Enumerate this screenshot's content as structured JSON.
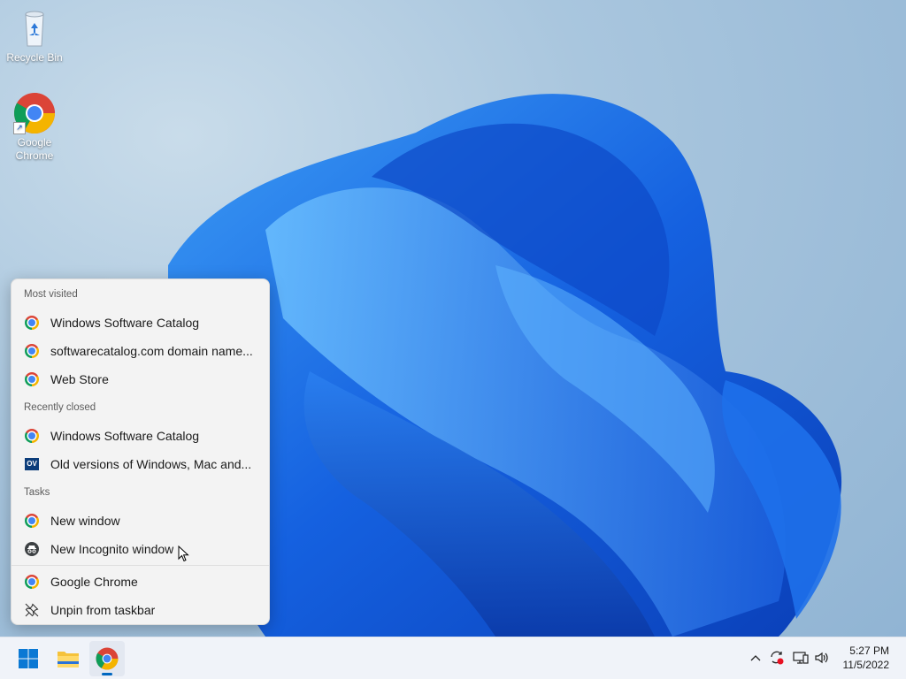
{
  "desktop": {
    "icons": [
      {
        "label": "Recycle Bin",
        "icon": "recycle-bin-icon"
      },
      {
        "label_line1": "Google",
        "label_line2": "Chrome",
        "icon": "chrome-icon"
      }
    ]
  },
  "jumplist": {
    "most_visited_label": "Most visited",
    "most_visited": [
      {
        "label": "Windows Software Catalog",
        "icon": "chrome-icon"
      },
      {
        "label": "softwarecatalog.com domain name...",
        "icon": "chrome-icon"
      },
      {
        "label": "Web Store",
        "icon": "chrome-icon"
      }
    ],
    "recently_closed_label": "Recently closed",
    "recently_closed": [
      {
        "label": "Windows Software Catalog",
        "icon": "chrome-icon"
      },
      {
        "label": "Old versions of Windows, Mac and...",
        "icon": "ov-favicon",
        "favicon_text": "OV"
      }
    ],
    "tasks_label": "Tasks",
    "tasks": [
      {
        "label": "New window",
        "icon": "chrome-icon"
      },
      {
        "label": "New Incognito window",
        "icon": "incognito-icon"
      }
    ],
    "app": [
      {
        "label": "Google Chrome",
        "icon": "chrome-icon"
      },
      {
        "label": "Unpin from taskbar",
        "icon": "unpin-icon"
      }
    ]
  },
  "taskbar": {
    "apps": [
      "start-button",
      "file-explorer",
      "google-chrome"
    ],
    "clock": {
      "time": "5:27 PM",
      "date": "11/5/2022"
    }
  },
  "colors": {
    "accent": "#0067c0",
    "wallpaper_blue": "#1a6fe0"
  }
}
